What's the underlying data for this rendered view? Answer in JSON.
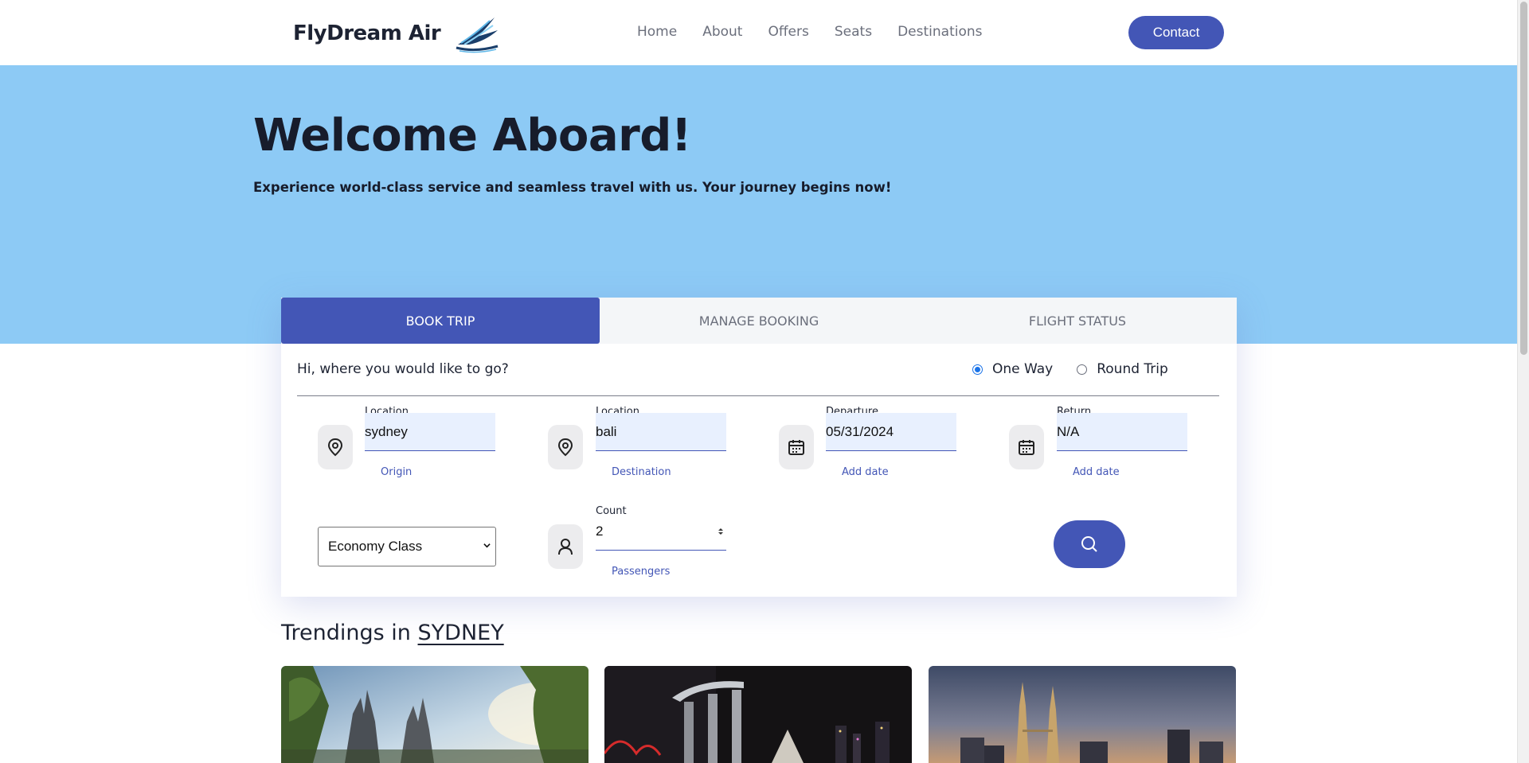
{
  "header": {
    "brand": "FlyDream Air",
    "nav": [
      "Home",
      "About",
      "Offers",
      "Seats",
      "Destinations"
    ],
    "contact_label": "Contact"
  },
  "hero": {
    "title": "Welcome Aboard!",
    "subtitle": "Experience world-class service and seamless travel with us. Your journey begins now!"
  },
  "booking": {
    "tabs": [
      "BOOK TRIP",
      "MANAGE BOOKING",
      "FLIGHT STATUS"
    ],
    "active_tab": "BOOK TRIP",
    "greeting": "Hi, where you would like to go?",
    "trip_types": [
      "One Way",
      "Round Trip"
    ],
    "selected_trip_type": "One Way",
    "origin": {
      "label": "Location",
      "value": "sydney",
      "hint": "Origin",
      "icon": "location-pin-icon"
    },
    "destination": {
      "label": "Location",
      "value": "bali",
      "hint": "Destination",
      "icon": "location-pin-icon"
    },
    "departure": {
      "label": "Departure",
      "value": "05/31/2024",
      "hint": "Add date",
      "icon": "calendar-icon"
    },
    "return": {
      "label": "Return",
      "value": "N/A",
      "hint": "Add date",
      "icon": "calendar-icon"
    },
    "cabin_class": "Economy Class",
    "passengers": {
      "label": "Count",
      "value": "2",
      "hint": "Passengers",
      "icon": "person-icon"
    },
    "search_icon": "search-icon"
  },
  "trending": {
    "prefix": "Trendings in",
    "city": "SYDNEY",
    "cards": [
      {
        "image": "bali-temple-gate"
      },
      {
        "image": "singapore-marina-bay-night"
      },
      {
        "image": "kuala-lumpur-petronas-towers"
      }
    ]
  },
  "colors": {
    "primary": "#4356b6",
    "hero_bg": "#8dcaf5",
    "tab_bg": "#f4f6f8",
    "input_bg": "#e8f0fe"
  }
}
